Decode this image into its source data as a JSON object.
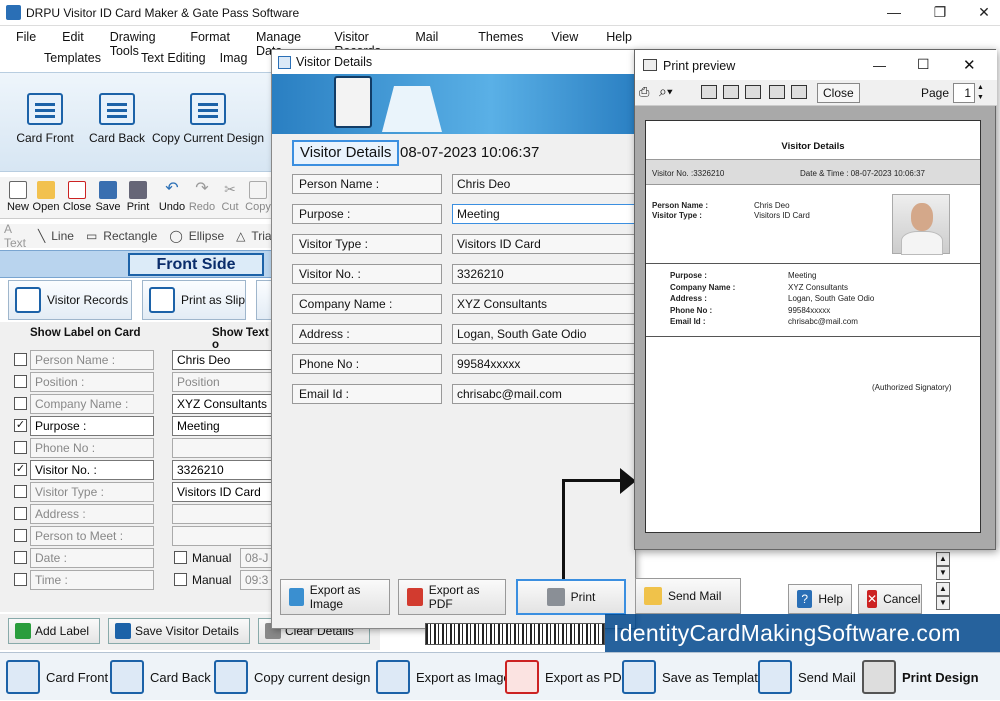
{
  "window": {
    "title": "DRPU Visitor ID Card Maker & Gate Pass Software",
    "minimize": "—",
    "maximize": "❐",
    "close": "✕"
  },
  "menu": [
    "File",
    "Edit",
    "Drawing Tools",
    "Format",
    "Manage Data",
    "Visitor Records",
    "Mail",
    "Themes",
    "View",
    "Help"
  ],
  "submenu": [
    "Templates",
    "Text Editing",
    "Imag"
  ],
  "ribbon": {
    "card_front": "Card Front",
    "card_back": "Card Back",
    "copy_design": "Copy Current Design"
  },
  "toolbar": [
    "New",
    "Open",
    "Close",
    "Save",
    "Print",
    "Undo",
    "Redo",
    "Cut",
    "Copy"
  ],
  "drawing": [
    "Text",
    "Line",
    "Rectangle",
    "Ellipse",
    "Trian"
  ],
  "front_side": "Front Side",
  "left_buttons": {
    "visitor_records": "Visitor Records",
    "print_as_slip": "Print as Slip"
  },
  "left_panel": {
    "show_label_header": "Show Label on Card",
    "show_text_header": "Show Text o",
    "rows": [
      {
        "label": "Person Name :",
        "checked": false,
        "value": "Chris Deo",
        "active": true
      },
      {
        "label": "Position :",
        "checked": false,
        "value": "Position",
        "active": false
      },
      {
        "label": "Company Name :",
        "checked": false,
        "value": "XYZ Consultants",
        "active": true
      },
      {
        "label": "Purpose :",
        "checked": true,
        "value": "Meeting",
        "active": true
      },
      {
        "label": "Phone No :",
        "checked": false,
        "value": "",
        "active": false
      },
      {
        "label": "Visitor No. :",
        "checked": true,
        "value": "3326210",
        "active": true
      },
      {
        "label": "Visitor Type :",
        "checked": false,
        "value": "Visitors ID Card",
        "active": true
      },
      {
        "label": "Address :",
        "checked": false,
        "value": "",
        "active": false
      },
      {
        "label": "Person to Meet :",
        "checked": false,
        "value": "",
        "active": false
      },
      {
        "label": "Date :",
        "checked": false,
        "manual": "Manual",
        "value": "08-J",
        "active": false
      },
      {
        "label": "Time :",
        "checked": false,
        "manual": "Manual",
        "value": "09:3",
        "active": false
      }
    ]
  },
  "bottom_left": {
    "add_label": "Add Label",
    "save_visitor": "Save Visitor Details",
    "clear": "Clear Details"
  },
  "visitor_details": {
    "title": "Visitor Details",
    "heading": "Visitor Details",
    "datetime": "08-07-2023 10:06:37",
    "fields": [
      {
        "label": "Person Name :",
        "value": "Chris Deo"
      },
      {
        "label": "Purpose :",
        "value": "Meeting"
      },
      {
        "label": "Visitor Type :",
        "value": "Visitors ID Card"
      },
      {
        "label": "Visitor No. :",
        "value": "3326210"
      },
      {
        "label": "Company Name :",
        "value": "XYZ Consultants"
      },
      {
        "label": "Address :",
        "value": "Logan, South Gate Odio"
      },
      {
        "label": "Phone No :",
        "value": "99584xxxxx"
      },
      {
        "label": "Email Id :",
        "value": "chrisabc@mail.com"
      }
    ],
    "buttons": {
      "export_image": "Export as Image",
      "export_pdf": "Export as PDF",
      "print": "Print",
      "send_mail": "Send Mail",
      "help": "Help",
      "cancel": "Cancel"
    }
  },
  "print_preview": {
    "title": "Print preview",
    "close": "Close",
    "page_label": "Page",
    "page_num": "1",
    "doc_title": "Visitor Details",
    "visitor_no": "Visitor No. :3326210",
    "date_time": "Date & Time : 08-07-2023 10:06:37",
    "person_name_label": "Person Name :",
    "person_name": "Chris Deo",
    "visitor_type_label": "Visitor Type :",
    "visitor_type": "Visitors ID Card",
    "details": [
      {
        "label": "Purpose :",
        "value": "Meeting"
      },
      {
        "label": "Company Name :",
        "value": "XYZ Consultants"
      },
      {
        "label": "Address :",
        "value": "Logan, South Gate Odio"
      },
      {
        "label": "Phone No :",
        "value": "99584xxxxx"
      },
      {
        "label": "Email Id :",
        "value": "chrisabc@mail.com"
      }
    ],
    "signatory": "(Authorized Signatory)"
  },
  "watermark": "IdentityCardMakingSoftware.com",
  "strip": [
    "Card Front",
    "Card Back",
    "Copy current design",
    "Export as Image",
    "Export as PDF",
    "Save as Template",
    "Send Mail",
    "Print Design"
  ]
}
